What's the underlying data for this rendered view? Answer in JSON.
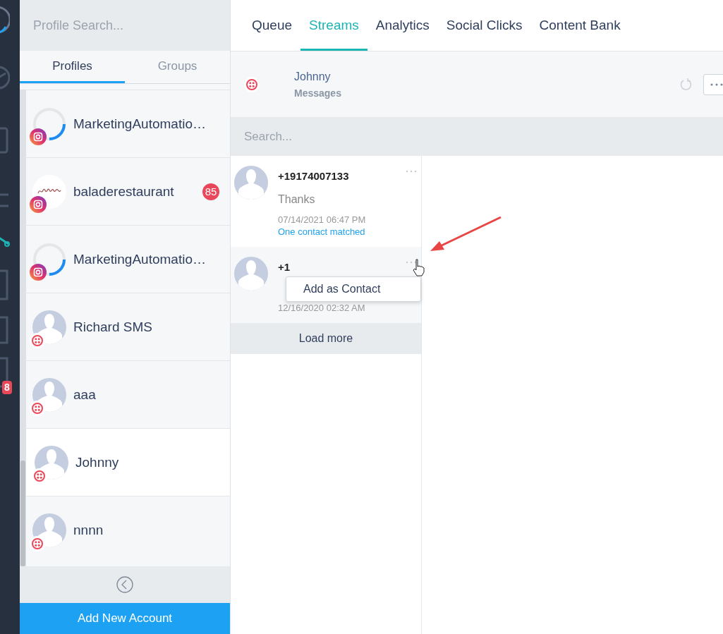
{
  "nav_rail": {
    "badge": "8"
  },
  "sidebar": {
    "search": {
      "placeholder": "Profile Search..."
    },
    "tabs": [
      {
        "label": "Profiles",
        "selected": true
      },
      {
        "label": "Groups",
        "selected": false
      }
    ],
    "profiles": [
      {
        "name": "MarketingAutomatio…",
        "kind": "spinner",
        "selected": false
      },
      {
        "name": "baladerestaurant",
        "kind": "logo",
        "badge": "85",
        "selected": false
      },
      {
        "name": "MarketingAutomatio…",
        "kind": "spinner",
        "selected": false
      },
      {
        "name": "Richard SMS",
        "kind": "sms",
        "selected": false
      },
      {
        "name": "aaa",
        "kind": "sms",
        "selected": false
      },
      {
        "name": "Johnny",
        "kind": "sms",
        "selected": true
      },
      {
        "name": "nnnn",
        "kind": "sms",
        "selected": false
      }
    ],
    "add_button": "Add New Account"
  },
  "top_tabs": [
    {
      "label": "Queue",
      "selected": false
    },
    {
      "label": "Streams",
      "selected": true
    },
    {
      "label": "Analytics",
      "selected": false
    },
    {
      "label": "Social Clicks",
      "selected": false
    },
    {
      "label": "Content Bank",
      "selected": false
    }
  ],
  "stream": {
    "title": "Johnny",
    "subtitle": "Messages",
    "search": {
      "placeholder": "Search..."
    },
    "messages": [
      {
        "sender": "+19174007133",
        "text": "Thanks",
        "time": "07/14/2021 06:47 PM",
        "status": "One contact matched",
        "hovered": false
      },
      {
        "sender": "+1",
        "time": "12/16/2020 02:32 AM",
        "hovered": true
      }
    ],
    "load_more": "Load more",
    "context_menu": [
      "Add as Contact"
    ]
  }
}
